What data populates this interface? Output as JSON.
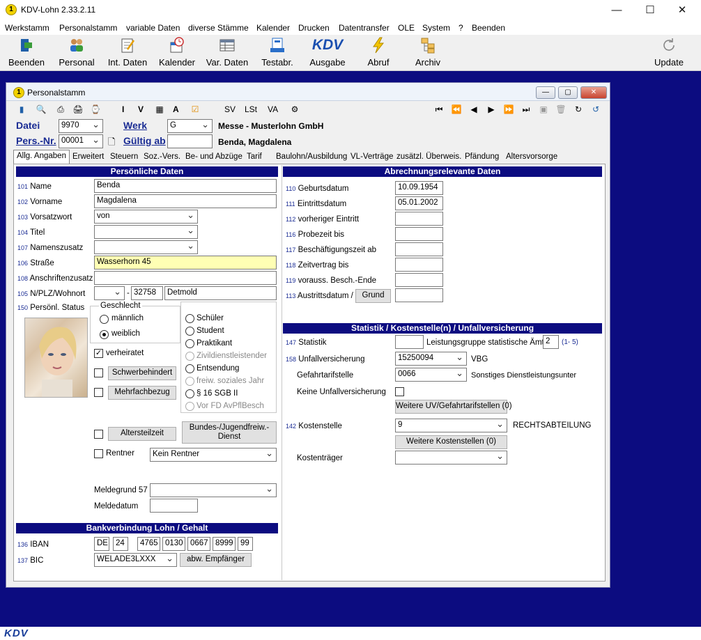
{
  "app": {
    "title": "KDV-Lohn 2.33.2.11",
    "icon": "1"
  },
  "menu": [
    "Werkstamm",
    "Personalstamm",
    "variable Daten",
    "diverse Stämme",
    "Kalender",
    "Drucken",
    "Datentransfer",
    "OLE",
    "System",
    "?",
    "Beenden"
  ],
  "toolbar": [
    {
      "label": "Beenden",
      "icon": "exit-icon"
    },
    {
      "label": "Personal",
      "icon": "people-icon"
    },
    {
      "label": "Int. Daten",
      "icon": "notepad-icon"
    },
    {
      "label": "Kalender",
      "icon": "calendar-icon"
    },
    {
      "label": "Var. Daten",
      "icon": "table-icon"
    },
    {
      "label": "Testabr.",
      "icon": "test-icon"
    },
    {
      "label": "Ausgabe",
      "icon": "kdv-logo"
    },
    {
      "label": "Abruf",
      "icon": "lightning-icon"
    },
    {
      "label": "Archiv",
      "icon": "archive-icon"
    },
    {
      "label": "Update",
      "icon": "refresh-icon"
    }
  ],
  "toolbar_logo_text": "KDV",
  "status_logo": "KDV",
  "child": {
    "title": "Personalstamm",
    "toolbar_text": [
      "I",
      "V",
      "A",
      "SV",
      "LSt",
      "VA"
    ],
    "datei_label": "Datei",
    "datei_value": "9970",
    "werk_label": "Werk",
    "werk_value": "G",
    "company": "Messe - Musterlohn GmbH",
    "persnr_label": "Pers.-Nr.",
    "persnr_value": "00001",
    "gueltig_label": "Gültig ab",
    "gueltig_value": "",
    "employee_name": "Benda, Magdalena"
  },
  "tabs": [
    "Allg. Angaben",
    "Erweitert",
    "Steuern",
    "Soz.-Vers.",
    "Be- und Abzüge",
    "Tarif",
    "Baulohn/Ausbildung",
    "VL-Verträge",
    "zusätzl. Überweis.",
    "Pfändung",
    "Altersvorsorge"
  ],
  "personal": {
    "header": "Persönliche Daten",
    "fields": [
      {
        "num": "101",
        "label": "Name",
        "value": "Benda"
      },
      {
        "num": "102",
        "label": "Vorname",
        "value": "Magdalena"
      },
      {
        "num": "103",
        "label": "Vorsatzwort",
        "value": "von"
      },
      {
        "num": "104",
        "label": "Titel",
        "value": ""
      },
      {
        "num": "107",
        "label": "Namenszusatz",
        "value": ""
      },
      {
        "num": "106",
        "label": "Straße",
        "value": "Wasserhorn 45"
      },
      {
        "num": "108",
        "label": "Anschriftenzusatz",
        "value": ""
      },
      {
        "num": "105",
        "label": "N/PLZ/Wohnort",
        "value": ""
      },
      {
        "num": "150",
        "label": "Persönl. Status",
        "value": ""
      }
    ],
    "plz": "32758",
    "ort": "Detmold",
    "plz_sep": "-",
    "geschlecht_label": "Geschlecht",
    "geschlecht": [
      "männlich",
      "weiblich"
    ],
    "status_options": [
      "Schüler",
      "Student",
      "Praktikant",
      "Zivildienstleistender",
      "Entsendung",
      "freiw. soziales Jahr",
      "§ 16 SGB II",
      "Vor FD AvPflBesch"
    ],
    "verheiratet": "verheiratet",
    "schwerbehindert": "Schwerbehindert",
    "mehrfachbezug": "Mehrfachbezug",
    "altersteilzeit": "Altersteilzeit",
    "bundes": "Bundes-/Jugendfreiw.-Dienst",
    "rentner_label": "Rentner",
    "rentner_value": "Kein Rentner",
    "meldegrund_label": "Meldegrund 57",
    "meldegrund_value": "",
    "meldedatum_label": "Meldedatum",
    "meldedatum_value": ""
  },
  "bank": {
    "header": "Bankverbindung Lohn / Gehalt",
    "iban_num": "136",
    "iban_label": "IBAN",
    "iban": [
      "DE",
      "24",
      "4765",
      "0130",
      "0667",
      "8999",
      "99"
    ],
    "bic_num": "137",
    "bic_label": "BIC",
    "bic": "WELADE3LXXX",
    "empf_button": "abw. Empfänger"
  },
  "abrechnung": {
    "header": "Abrechnungsrelevante Daten",
    "fields": [
      {
        "num": "110",
        "label": "Geburtsdatum",
        "value": "10.09.1954"
      },
      {
        "num": "111",
        "label": "Eintrittsdatum",
        "value": "05.01.2002"
      },
      {
        "num": "112",
        "label": "vorheriger Eintritt",
        "value": ""
      },
      {
        "num": "116",
        "label": "Probezeit bis",
        "value": ""
      },
      {
        "num": "117",
        "label": "Beschäftigungszeit ab",
        "value": ""
      },
      {
        "num": "118",
        "label": "Zeitvertrag bis",
        "value": ""
      },
      {
        "num": "119",
        "label": "vorauss. Besch.-Ende",
        "value": ""
      },
      {
        "num": "113",
        "label": "Austrittsdatum /",
        "value": ""
      }
    ],
    "grund_button": "Grund"
  },
  "statistik": {
    "header": "Statistik / Kostenstelle(n) / Unfallversicherung",
    "statistik_num": "147",
    "statistik_label": "Statistik",
    "statistik_value": "",
    "leistungsgruppe_label": "Leistungsgruppe statistische Ämter",
    "leistungsgruppe_value": "2",
    "leistungsgruppe_hint": "(1- 5)",
    "uv_num": "158",
    "uv_label": "Unfallversicherung",
    "uv_value": "15250094",
    "uv_text": "VBG",
    "gefahr_label": "Gefahrtarifstelle",
    "gefahr_value": "0066",
    "gefahr_text": "Sonstiges Dienstleistungsunter",
    "keine_uv_label": "Keine Unfallversicherung",
    "weitere_uv_button": "Weitere UV/Gefahrtarifstellen (0)",
    "kst_num": "142",
    "kst_label": "Kostenstelle",
    "kst_value": "9",
    "kst_text": "RECHTSABTEILUNG",
    "weitere_kst_button": "Weitere Kostenstellen (0)",
    "kostentraeger_label": "Kostenträger",
    "kostentraeger_value": ""
  }
}
